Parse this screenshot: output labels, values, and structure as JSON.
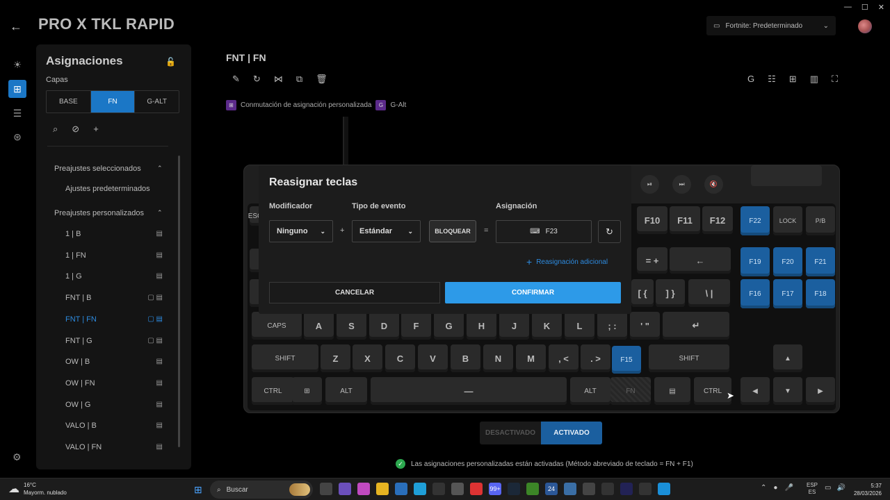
{
  "window": {
    "title": "PRO X TKL RAPID",
    "controls": [
      "—",
      "☐",
      "✕"
    ]
  },
  "profile": {
    "label": "Fortnite: Predeterminado"
  },
  "sidebar": {
    "title": "Asignaciones",
    "layers_label": "Capas",
    "layers": [
      "BASE",
      "FN",
      "G-ALT"
    ],
    "active_layer": "FN",
    "selected_presets": {
      "header": "Preajustes seleccionados",
      "items": [
        "Ajustes predeterminados"
      ]
    },
    "custom_presets": {
      "header": "Preajustes personalizados",
      "items": [
        {
          "label": "1 | B"
        },
        {
          "label": "1 | FN"
        },
        {
          "label": "1 | G"
        },
        {
          "label": "FNT | B",
          "badge": "B"
        },
        {
          "label": "FNT | FN",
          "badge": "FN",
          "active": true
        },
        {
          "label": "FNT | G",
          "badge": "G"
        },
        {
          "label": "OW | B"
        },
        {
          "label": "OW | FN"
        },
        {
          "label": "OW | G"
        },
        {
          "label": "VALO | B"
        },
        {
          "label": "VALO | FN"
        }
      ]
    }
  },
  "main": {
    "title": "FNT | FN",
    "legend": [
      {
        "swatch": "⊞",
        "label": "Conmutación de asignación personalizada"
      },
      {
        "swatch": "G",
        "label": "G-Alt"
      }
    ]
  },
  "keyboard": {
    "keys": {
      "esc": "ESC",
      "f10": "F10",
      "f11": "F11",
      "f12": "F12",
      "f22": "F22",
      "lock": "LOCK",
      "pb": "P/B",
      "eq": "= +",
      "bksp": "←",
      "f19": "F19",
      "f20": "F20",
      "f21": "F21",
      "lbr": "[ {",
      "rbr": "] }",
      "bsl": "\\ |",
      "f16": "F16",
      "f17": "F17",
      "f18": "F18",
      "caps": "CAPS",
      "a": "A",
      "s": "S",
      "d": "D",
      "f": "F",
      "g": "G",
      "h": "H",
      "j": "J",
      "k": "K",
      "l": "L",
      "semi": "; :",
      "quote": "' \"",
      "enter": "↵",
      "shift_l": "SHIFT",
      "z": "Z",
      "x": "X",
      "c": "C",
      "v": "V",
      "b": "B",
      "n": "N",
      "m": "M",
      "comma": ", <",
      "period": ". >",
      "f15": "F15",
      "shift_r": "SHIFT",
      "up": "▲",
      "ctrl_l": "CTRL",
      "win": "⊞",
      "alt_l": "ALT",
      "space": "—",
      "alt_r": "ALT",
      "fn": "FN",
      "menu": "▤",
      "ctrl_r": "CTRL",
      "left": "◀",
      "down": "▼",
      "right": "▶"
    },
    "media": [
      "⏯",
      "⏭",
      "🔇"
    ]
  },
  "dialog": {
    "title": "Reasignar teclas",
    "modifier_label": "Modificador",
    "modifier_value": "Ninguno",
    "event_label": "Tipo de evento",
    "event_value": "Estándar",
    "lock_button": "BLOQUEAR",
    "assignment_label": "Asignación",
    "assignment_value": "F23",
    "plus": "+",
    "equals": "=",
    "add_link": "Reasignación adicional",
    "cancel": "CANCELAR",
    "confirm": "CONFIRMAR"
  },
  "toggle": {
    "off": "DESACTIVADO",
    "on": "ACTIVADO"
  },
  "status_text": "Las asignaciones personalizadas están activadas (Método abreviado de teclado = FN + F1)",
  "taskbar": {
    "weather_temp": "16°C",
    "weather_desc": "Mayorm. nublado",
    "search_placeholder": "Buscar",
    "lang_line1": "ESP",
    "lang_line2": "ES",
    "time": "5:37",
    "date": "28/03/2026",
    "badges": {
      "discord": "99+",
      "teams": "24"
    }
  }
}
